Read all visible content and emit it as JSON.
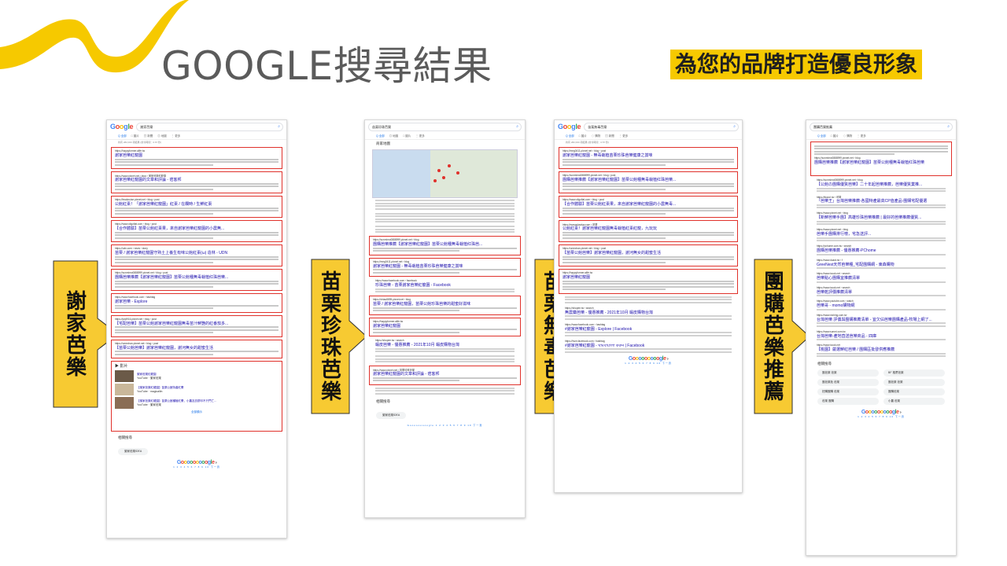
{
  "title": "GOOGLE搜尋結果",
  "tagline": "為您的品牌打造優良形象",
  "colors": {
    "accent": "#f6c900",
    "highlight_border": "#e0312b",
    "title": "#5b5b5b",
    "arrow_fill": "#f7ca32"
  },
  "arrows": [
    {
      "label": "謝家芭樂"
    },
    {
      "label": "苗栗珍珠芭樂"
    },
    {
      "label": "苗栗無毒芭樂"
    },
    {
      "label": "團購芭樂推薦"
    }
  ],
  "shots": [
    {
      "query": "謝家芭樂",
      "stats": "約有 282,000 項結果 (搜尋時間：0.67 秒)",
      "results": [
        {
          "url": "https://happyformer.alife.tw",
          "title": "謝家芭樂紅龍園"
        },
        {
          "url": "https://www.pixnet.net › blog › 謝家芭樂紅龍園",
          "title": "謝家芭樂紅龍園的文章和評論 - 痞客邦"
        },
        {
          "url": "https://leadcruise.pixnet.net › blog › post",
          "title": "公館紅棗！「謝家芭樂紅龍園」紅棗 / 在欄時 / 生鮮紅棗"
        },
        {
          "url": "https://www.oligofiat.com › blog › post",
          "title": "【合作體驗】苗栗公館紅棗果，來自謝家芭樂紅龍園的小農無..."
        },
        {
          "url": "https://udn.com › news › story",
          "title": "苗栗 / 謝家芭樂紅龍園守熟土上養生有味公館紅棗(ω) 造林 - UDN"
        },
        {
          "url": "https://sunmimo0888999.pixnet.net › blog › post",
          "title": "團購芭樂推薦【謝家芭樂紅龍園】苗栗公館種無毒栽植红珠芭樂..."
        },
        {
          "url": "https://www.facebook.com › hashtag",
          "title": "謝家芭樂 - Explore"
        },
        {
          "url": "https://jusli916.pixnet.net › blog › post",
          "title": "【宅配芭樂】苗栗公館謝家芭樂紅龍園無毒苗汁鮮艷的紅番茄多..."
        },
        {
          "url": "https://umechan.pixnet.net › blog › post",
          "title": "【苗栗公館芭樂】謝家芭樂紅龍園，謝河無女的甜蜜生活"
        }
      ],
      "videos_label": "影片",
      "videos": [
        {
          "title": "謝家芭樂紅龍園",
          "source": "YouTube · 謝家芭樂"
        },
        {
          "title": "【謝家芭樂紅龍園】苗栗公館特產紅棗",
          "source": "YouTube · magicallin"
        },
        {
          "title": "【謝家芭樂紅龍園】苗栗公館種植紅棗，小農友訪膠印不只門亡...",
          "source": "YouTube · 謝家芭樂"
        }
      ],
      "more_label": "全部顯示",
      "related_label": "相關搜尋",
      "related_chip": "謝家芭樂IDEA"
    },
    {
      "query": "苗栗珍珠芭樂",
      "map_label": "商家地圖",
      "results": [
        {
          "url": "https://sunmimo0888999.pixnet.net › blog",
          "title": "團購芭樂推薦【謝家芭樂紅龍園】苗栗公館種無毒栽植红珠芭..."
        },
        {
          "url": "https://meg0411.pixnet.net › blog",
          "title": "謝家芭樂紅龍園 - 無毒栽植苗栗珍珠芭樂健康之賞味"
        },
        {
          "url": "https://www.facebook.com › facebook",
          "title": "珍珠芭樂 - 苗栗謝家芭樂紅龍園 - Facebook"
        },
        {
          "url": "https://chiao8895.pixnet.net › blog",
          "title": "苗栗 / 謝家芭樂紅龍園，苗栗公館珍珠芭樂的甜蜜好滋味"
        },
        {
          "url": "https://happyformer.alife.tw",
          "title": "謝家芭樂紅龍園"
        },
        {
          "url": "https://shopee.tw › search",
          "title": "蝦皮芭樂 - 優惠推薦 - 2021年10月 蝦皮購物台灣"
        },
        {
          "url": "https://www.pixnet.net › 苗栗珍珠芭樂",
          "title": "謝家芭樂紅龍園的文章和評論 - 痞客邦"
        }
      ],
      "related_label": "相關搜尋",
      "related_chip": "謝家芭樂IDEA"
    },
    {
      "query": "苗栗無毒芭樂",
      "stats": "約有 282,000 項結果 (搜尋時間：0.57 秒)",
      "results": [
        {
          "url": "https://meg0411.pixnet.net › blog › post",
          "title": "謝家芭樂紅龍園 - 無毒栽植苗栗珍珠芭樂健康之賞味"
        },
        {
          "url": "https://sunmimo0888999.pixnet.net › blog › post",
          "title": "團購芭樂推薦【謝家芭樂紅龍園】苗栗公館種無毒栽植红珠芭樂..."
        },
        {
          "url": "https://www.oligofiat.com › blog › post",
          "title": "【合作體驗】苗栗公館紅棗果，來自謝家芭樂紅龍園的小農無毒..."
        },
        {
          "url": "https://mangolayday.com › 苗栗",
          "title": "公館紅棗！謝家芭樂紅龍園無毒栽植紅棗紅龍，九玩玩"
        },
        {
          "url": "https://umechan.pixnet.net › blog › post",
          "title": "【苗栗公館芭樂】謝家芭樂紅龍園，謝河無女的甜蜜生活"
        },
        {
          "url": "https://happyformer.alife.tw",
          "title": "謝家芭樂紅龍園"
        }
      ],
      "plain_results": [
        {
          "url": "https://shopee.tw › search",
          "title": "無農藥芭樂 - 優惠推薦 - 2021年10月 蝦皮購物台灣"
        },
        {
          "url": "https://www.facebook.com › hashtag",
          "title": "#謝家芭樂紅龍園 - Explore | Facebook"
        },
        {
          "url": "https://hum.facebook.com › hashtag",
          "title": "#謝家芭樂紅龍園 - থামবায়ালা করুন | Facebook"
        }
      ]
    },
    {
      "query": "團購芭樂推薦",
      "results": [
        {
          "url": "https://sunmimo0888999.pixnet.net › blog",
          "title": "團購芭樂推薦【謝家芭樂紅龍園】苗栗公館種無毒栽植红珠芭樂"
        }
      ],
      "plain_results": [
        {
          "url": "https://sunmimo0888999.pixnet.net › blog",
          "title": "【公館の團購優質芭樂】二十年起芭樂推薦，芭樂優質業推..."
        },
        {
          "url": "https://tinyurl.tw › 芭樂",
          "title": "「芭樂王」台灣芭樂推薦-各國特產最高CP值產品-團購宅配優選"
        },
        {
          "url": "https://www.pixnet.net › blog",
          "title": "【新鮮芭樂手團】高雄珍珠芭樂推薦 | 最好的芭樂推薦優質..."
        },
        {
          "url": "https://www.pixnet.net › blog",
          "title": "芭樂手團購排行榜，宅急送評..."
        },
        {
          "url": "https://pchome.com.tw › search",
          "title": "團購芭樂推薦 - 優惠推薦-PChome"
        },
        {
          "url": "https://www.dcard.tw › f",
          "title": "GreeNest天然芭樂種_宅配團購網 - 東森購物"
        },
        {
          "url": "https://www.icook.net › search",
          "title": "芭樂點心團購宜推薦清單"
        },
        {
          "url": "https://www.icook.net › search",
          "title": "芭樂乾評價推薦清單"
        },
        {
          "url": "https://www.youtube.com › watch",
          "title": "芭樂哥 - momo購物網"
        },
        {
          "url": "https://www.niching.com.tw",
          "title": "台灣芭樂 評價與團購推薦清單 - 宜欠佔芭樂團購產品-牧場上網了..."
        },
        {
          "url": "https://www.sunmi.com.tw",
          "title": "台灣芭樂-產地直送芭樂商品 - 四庫"
        },
        {
          "url": "https://www.icook.net",
          "title": "【桃園】嚴選鮮紅芭樂 / 團購區批發供應推薦"
        }
      ],
      "related_label": "相關搜尋",
      "related_chips": [
        "團芭樂 芭樂",
        "BF 推薦芭樂",
        "團芭樂批 芭樂",
        "團芭樂 芭樂",
        "拍購團購 芭樂",
        "團購芭樂",
        "芭樂 團購",
        "小農 芭樂"
      ]
    }
  ]
}
